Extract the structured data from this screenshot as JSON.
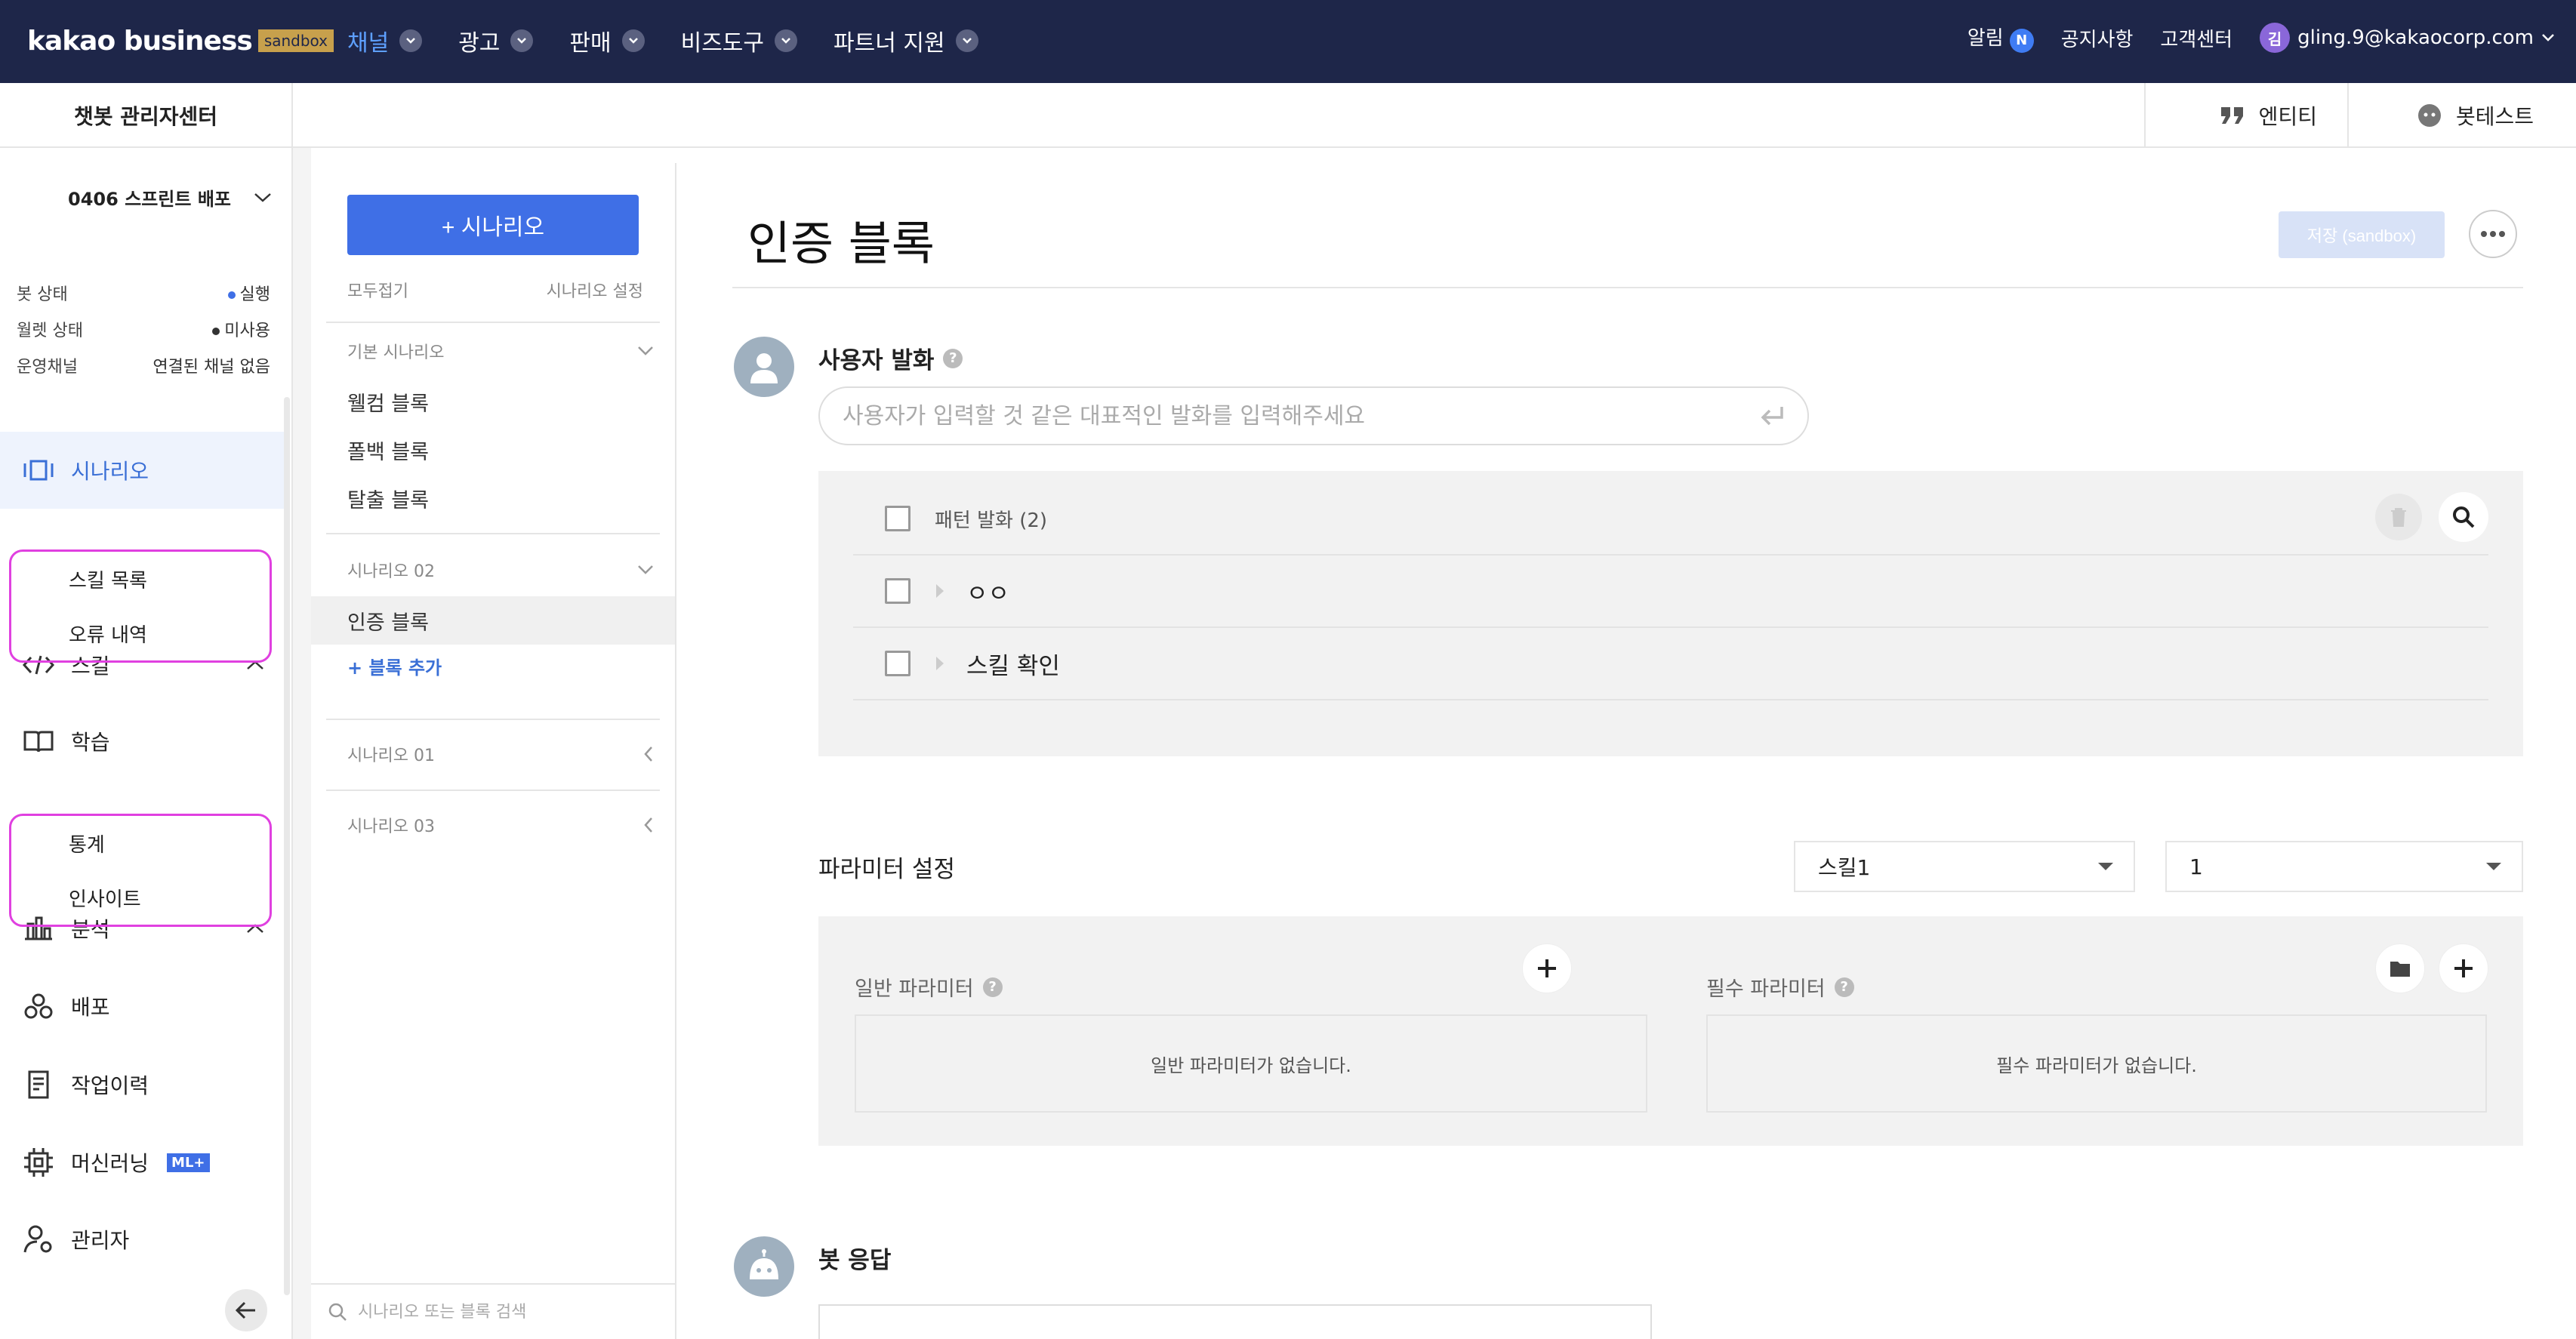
{
  "topnav": {
    "logo": "kakao business",
    "logo_badge": "sandbox",
    "menu": [
      {
        "label": "채널",
        "active": true
      },
      {
        "label": "광고",
        "active": false
      },
      {
        "label": "판매",
        "active": false
      },
      {
        "label": "비즈도구",
        "active": false
      },
      {
        "label": "파트너 지원",
        "active": false
      }
    ],
    "alarm_label": "알림",
    "alarm_badge": "N",
    "notice": "공지사항",
    "support": "고객센터",
    "avatar_initial": "김",
    "user_email": "gling.9@kakaocorp.com"
  },
  "subheader": {
    "title": "챗봇 관리자센터",
    "entity": "엔티티",
    "bottest": "봇테스트"
  },
  "sidebar": {
    "bot_name": "0406 스프린트 배포",
    "status": [
      {
        "label": "봇 상태",
        "value": "실행",
        "dot": "#3f6fe6"
      },
      {
        "label": "월렛 상태",
        "value": "미사용",
        "dot": "#333333"
      },
      {
        "label": "운영채널",
        "value": "연결된 채널 없음",
        "dot": ""
      }
    ],
    "menu": {
      "scenario": "시나리오",
      "skill": "스킬",
      "skill_sub": [
        "스킬 목록",
        "오류 내역"
      ],
      "learning": "학습",
      "analysis": "분석",
      "analysis_sub": [
        "통계",
        "인사이트"
      ],
      "deploy": "배포",
      "history": "작업이력",
      "ml": "머신러닝",
      "ml_badge": "ML+",
      "admin": "관리자"
    }
  },
  "scenario_panel": {
    "add_button": "+ 시나리오",
    "collapse_all": "모두접기",
    "settings": "시나리오 설정",
    "groups": [
      {
        "name": "기본 시나리오",
        "items": [
          "웰컴 블록",
          "폴백 블록",
          "탈출 블록"
        ]
      },
      {
        "name": "시나리오 02",
        "items": [
          "인증 블록"
        ],
        "add_block": "+ 블록 추가"
      },
      {
        "name": "시나리오 01",
        "items": []
      },
      {
        "name": "시나리오 03",
        "items": []
      }
    ],
    "search_placeholder": "시나리오 또는 블록 검색"
  },
  "main": {
    "title": "인증 블록",
    "save_button": "저장 (sandbox)",
    "user_utter_label": "사용자 발화",
    "utter_placeholder": "사용자가 입력할 것 같은 대표적인 발화를 입력해주세요",
    "pattern_header": "패턴 발화 (2)",
    "patterns": [
      "ㅇㅇ",
      "스킬 확인"
    ],
    "param_label": "파라미터 설정",
    "skill_select": "스킬1",
    "value_select": "1",
    "general_param": "일반 파라미터",
    "general_empty": "일반 파라미터가 없습니다.",
    "required_param": "필수 파라미터",
    "required_empty": "필수 파라미터가 없습니다.",
    "bot_response_label": "봇 응답"
  },
  "colors": {
    "nav_bg": "#1e2649",
    "accent": "#3f6fe6",
    "highlight_border": "#e040e0"
  }
}
